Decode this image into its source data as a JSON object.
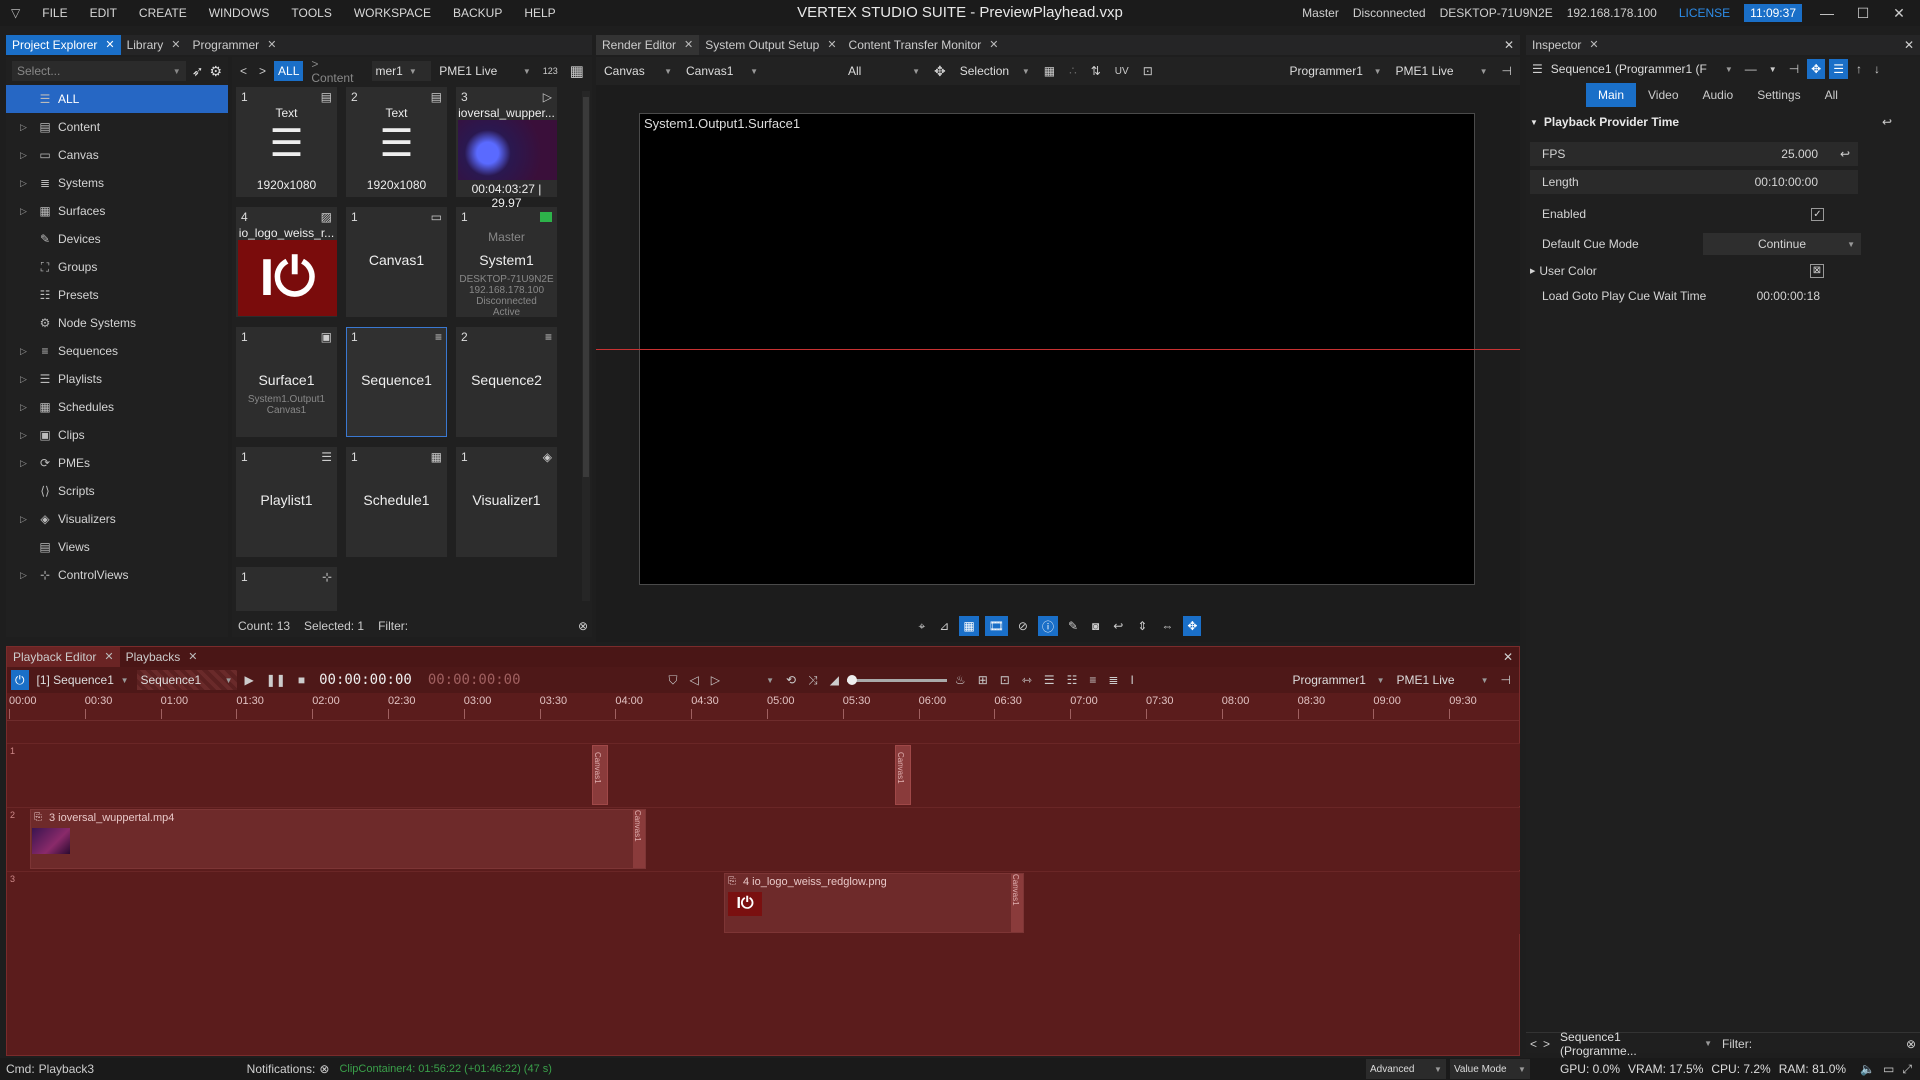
{
  "menu": [
    "FILE",
    "EDIT",
    "CREATE",
    "WINDOWS",
    "TOOLS",
    "WORKSPACE",
    "BACKUP",
    "HELP"
  ],
  "app_title": "VERTEX STUDIO SUITE - PreviewPlayhead.vxp",
  "status": {
    "role": "Master",
    "connection": "Disconnected",
    "host": "DESKTOP-71U9N2E",
    "ip": "192.168.178.100",
    "license": "LICENSE",
    "time": "11:09:37"
  },
  "left_tabs": [
    {
      "label": "Project Explorer"
    },
    {
      "label": "Library"
    },
    {
      "label": "Programmer"
    }
  ],
  "center_tabs": [
    {
      "label": "Render Editor"
    },
    {
      "label": "System Output Setup"
    },
    {
      "label": "Content Transfer Monitor"
    }
  ],
  "right_tabs": [
    {
      "label": "Inspector"
    }
  ],
  "explorer": {
    "select_placeholder": "Select...",
    "tree": [
      {
        "label": "ALL",
        "icon": "list-icon"
      },
      {
        "label": "Content",
        "icon": "content-icon"
      },
      {
        "label": "Canvas",
        "icon": "canvas-icon"
      },
      {
        "label": "Systems",
        "icon": "systems-icon"
      },
      {
        "label": "Surfaces",
        "icon": "surfaces-icon"
      },
      {
        "label": "Devices",
        "icon": "devices-icon"
      },
      {
        "label": "Groups",
        "icon": "groups-icon"
      },
      {
        "label": "Presets",
        "icon": "presets-icon"
      },
      {
        "label": "Node Systems",
        "icon": "node-icon"
      },
      {
        "label": "Sequences",
        "icon": "sequences-icon"
      },
      {
        "label": "Playlists",
        "icon": "playlists-icon"
      },
      {
        "label": "Schedules",
        "icon": "schedules-icon"
      },
      {
        "label": "Clips",
        "icon": "clips-icon"
      },
      {
        "label": "PMEs",
        "icon": "pme-icon"
      },
      {
        "label": "Scripts",
        "icon": "scripts-icon"
      },
      {
        "label": "Visualizers",
        "icon": "visualizers-icon"
      },
      {
        "label": "Views",
        "icon": "views-icon"
      },
      {
        "label": "ControlViews",
        "icon": "controlviews-icon"
      }
    ],
    "crumb_all": "ALL",
    "crumb_content": "> Content",
    "programmer": "mer1",
    "pme": "PME1 Live",
    "num_badge": "123",
    "tiles": [
      {
        "num": "1",
        "header": "Text",
        "name": "1920x1080",
        "icon": "text-icon"
      },
      {
        "num": "2",
        "header": "Text",
        "name": "1920x1080",
        "icon": "text-icon"
      },
      {
        "num": "3",
        "header": "ioversal_wupper...",
        "name": "00:04:03:27 | 29.97",
        "icon": "video-icon"
      },
      {
        "num": "4",
        "header": "io_logo_weiss_r...",
        "name": "",
        "icon": "image-icon"
      },
      {
        "num": "1",
        "header": "",
        "name": "Canvas1",
        "icon": "canvas-icon"
      },
      {
        "num": "1",
        "header": "Master",
        "name": "System1",
        "sub": "DESKTOP-71U9N2E\n192.168.178.100\nDisconnected\nActive",
        "icon": "system-icon"
      },
      {
        "num": "1",
        "header": "",
        "name": "Surface1",
        "sub": "System1.Output1\nCanvas1",
        "icon": "surface-icon"
      },
      {
        "num": "1",
        "header": "",
        "name": "Sequence1",
        "icon": "sequence-icon"
      },
      {
        "num": "2",
        "header": "",
        "name": "Sequence2",
        "icon": "sequence-icon"
      },
      {
        "num": "1",
        "header": "",
        "name": "Playlist1",
        "icon": "playlist-icon"
      },
      {
        "num": "1",
        "header": "",
        "name": "Schedule1",
        "icon": "schedule-icon"
      },
      {
        "num": "1",
        "header": "",
        "name": "Visualizer1",
        "icon": "visualizer-icon"
      },
      {
        "num": "1",
        "header": "",
        "name": "",
        "icon": "controlview-icon"
      }
    ],
    "count_label": "Count: 13",
    "selected_label": "Selected: 1",
    "filter_label": "Filter:"
  },
  "render": {
    "view_dd": "Canvas",
    "canvas_dd": "Canvas1",
    "filter_dd": "All",
    "mode_dd": "Selection",
    "programmer_dd": "Programmer1",
    "pme_dd": "PME1 Live",
    "surface_label": "System1.Output1.Surface1"
  },
  "inspector": {
    "target": "Sequence1 (Programmer1 (F",
    "tabs": [
      "Main",
      "Video",
      "Audio",
      "Settings",
      "All"
    ],
    "section": "Playback Provider Time",
    "fps_label": "FPS",
    "fps_value": "25.000",
    "length_label": "Length",
    "length_value": "00:10:00:00",
    "enabled_label": "Enabled",
    "cue_mode_label": "Default Cue Mode",
    "cue_mode_value": "Continue",
    "user_color_label": "User Color",
    "wait_label": "Load Goto Play Cue Wait Time",
    "wait_value": "00:00:00:18",
    "footer_target": "Sequence1 (Programme...",
    "footer_filter": "Filter:"
  },
  "playback": {
    "tabs": [
      {
        "label": "Playback Editor"
      },
      {
        "label": "Playbacks"
      }
    ],
    "sequence_dd": "[1] Sequence1",
    "sequence_name": "Sequence1",
    "timecode": "00:00:00:00",
    "timecode2": "00:00:00:00",
    "programmer_dd": "Programmer1",
    "pme_dd": "PME1 Live",
    "ruler": [
      "00:00",
      "00:30",
      "01:00",
      "01:30",
      "02:00",
      "02:30",
      "03:00",
      "03:30",
      "04:00",
      "04:30",
      "05:00",
      "05:30",
      "06:00",
      "06:30",
      "07:00",
      "07:30",
      "08:00",
      "08:30",
      "09:00",
      "09:30"
    ],
    "track_nums": [
      "1",
      "2",
      "3"
    ],
    "clip_video": "3 ioversal_wuppertal.mp4",
    "clip_logo": "4 io_logo_weiss_redglow.png",
    "canvas_tag": "Canvas1"
  },
  "footer": {
    "cmd_label": "Cmd:",
    "cmd_value": "Playback3",
    "notifications": "Notifications:",
    "notice": "ClipContainer4: 01:56:22 (+01:46:22) (47 s)",
    "advanced": "Advanced",
    "value_mode": "Value Mode",
    "gpu": "GPU: 0.0%",
    "vram": "VRAM: 17.5%",
    "cpu": "CPU: 7.2%",
    "ram": "RAM: 81.0%"
  },
  "colors": {
    "accent": "#1a6fc8",
    "timeline_bg": "#5b1c1c",
    "green": "#2db34a",
    "notice": "#3aa04a"
  }
}
